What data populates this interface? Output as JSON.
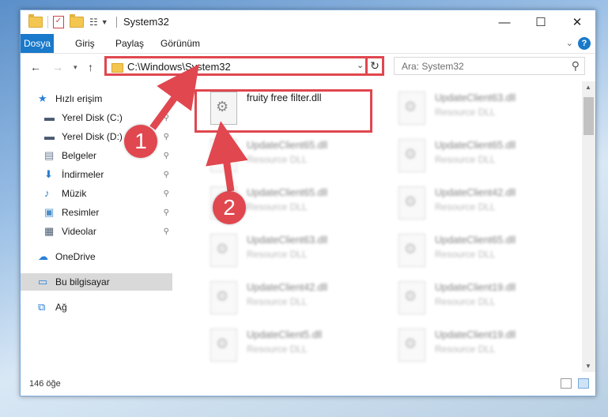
{
  "window": {
    "title": "System32",
    "controls": {
      "minimize": "—",
      "maximize": "☐",
      "close": "✕"
    }
  },
  "ribbon": {
    "tabs": [
      "Dosya",
      "Giriş",
      "Paylaş",
      "Görünüm"
    ],
    "help": "?"
  },
  "address": {
    "path": "C:\\Windows\\System32",
    "search_placeholder": "Ara: System32"
  },
  "nav": {
    "items": [
      {
        "label": "Hızlı erişim",
        "icon": "star-icon",
        "pinned": false,
        "indent": false,
        "selected": false
      },
      {
        "label": "Yerel Disk (C:)",
        "icon": "drive-icon",
        "pinned": true,
        "indent": true,
        "selected": false
      },
      {
        "label": "Yerel Disk (D:)",
        "icon": "drive-icon",
        "pinned": true,
        "indent": true,
        "selected": false
      },
      {
        "label": "Belgeler",
        "icon": "documents-icon",
        "pinned": true,
        "indent": true,
        "selected": false
      },
      {
        "label": "İndirmeler",
        "icon": "download-icon",
        "pinned": true,
        "indent": true,
        "selected": false
      },
      {
        "label": "Müzik",
        "icon": "music-icon",
        "pinned": true,
        "indent": true,
        "selected": false
      },
      {
        "label": "Resimler",
        "icon": "pictures-icon",
        "pinned": true,
        "indent": true,
        "selected": false
      },
      {
        "label": "Videolar",
        "icon": "videos-icon",
        "pinned": true,
        "indent": true,
        "selected": false
      },
      {
        "label": "OneDrive",
        "icon": "cloud-icon",
        "pinned": false,
        "indent": false,
        "selected": false
      },
      {
        "label": "Bu bilgisayar",
        "icon": "computer-icon",
        "pinned": false,
        "indent": false,
        "selected": true
      },
      {
        "label": "Ağ",
        "icon": "network-icon",
        "pinned": false,
        "indent": false,
        "selected": false
      }
    ]
  },
  "files": {
    "highlighted": {
      "name": "fruity free filter.dll",
      "type": ""
    },
    "left_column": [
      {
        "name": "UpdateClient65.dll",
        "type": "Resource DLL"
      },
      {
        "name": "UpdateClient65.dll",
        "type": "Resource DLL"
      },
      {
        "name": "UpdateClient63.dll",
        "type": "Resource DLL"
      },
      {
        "name": "UpdateClient42.dll",
        "type": "Resource DLL"
      },
      {
        "name": "UpdateClient5.dll",
        "type": "Resource DLL"
      }
    ],
    "right_column": [
      {
        "name": "UpdateClient63.dll",
        "type": "Resource DLL"
      },
      {
        "name": "UpdateClient65.dll",
        "type": "Resource DLL"
      },
      {
        "name": "UpdateClient42.dll",
        "type": "Resource DLL"
      },
      {
        "name": "UpdateClient65.dll",
        "type": "Resource DLL"
      },
      {
        "name": "UpdateClient19.dll",
        "type": "Resource DLL"
      },
      {
        "name": "UpdateClient19.dll",
        "type": "Resource DLL"
      }
    ]
  },
  "status": {
    "count": "146 öğe"
  },
  "annotations": {
    "step1": "1",
    "step2": "2",
    "color": "#e0474f"
  }
}
